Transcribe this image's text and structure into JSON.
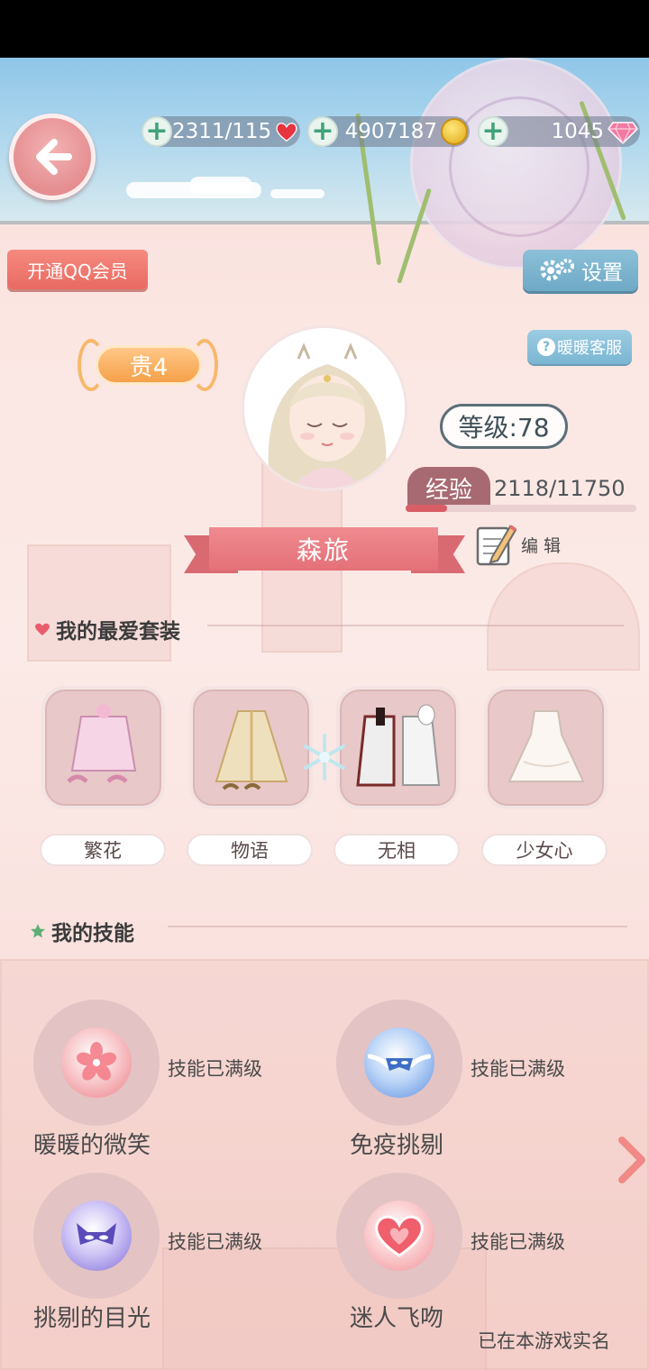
{
  "currencies": {
    "stamina": "2311/115",
    "gold": "4907187",
    "diamonds": "1045"
  },
  "buttons": {
    "qq_member": "开通QQ会员",
    "settings": "设置",
    "customer_service": "暖暖客服",
    "edit": "编 辑"
  },
  "profile": {
    "vip": "贵4",
    "level": "等级:78",
    "exp_label": "经验",
    "exp_value": "2118/11750",
    "exp_fraction": 0.18,
    "name": "森旅"
  },
  "favorites": {
    "title": "我的最爱套装",
    "outfits": [
      {
        "label": "繁花"
      },
      {
        "label": "物语"
      },
      {
        "label": "无相"
      },
      {
        "label": "少女心"
      }
    ]
  },
  "skills": {
    "title": "我的技能",
    "items": [
      {
        "name": "暖暖的微笑",
        "status": "技能已满级"
      },
      {
        "name": "免疫挑剔",
        "status": "技能已满级"
      },
      {
        "name": "挑剔的目光",
        "status": "技能已满级"
      },
      {
        "name": "迷人飞吻",
        "status": "技能已满级"
      }
    ]
  },
  "footer": {
    "realname_note": "已在本游戏实名"
  },
  "colors": {
    "accent_pink": "#e57078",
    "back_button": "#e58e91",
    "settings_blue": "#6ea9c6",
    "vip_orange": "#f5a14a"
  }
}
